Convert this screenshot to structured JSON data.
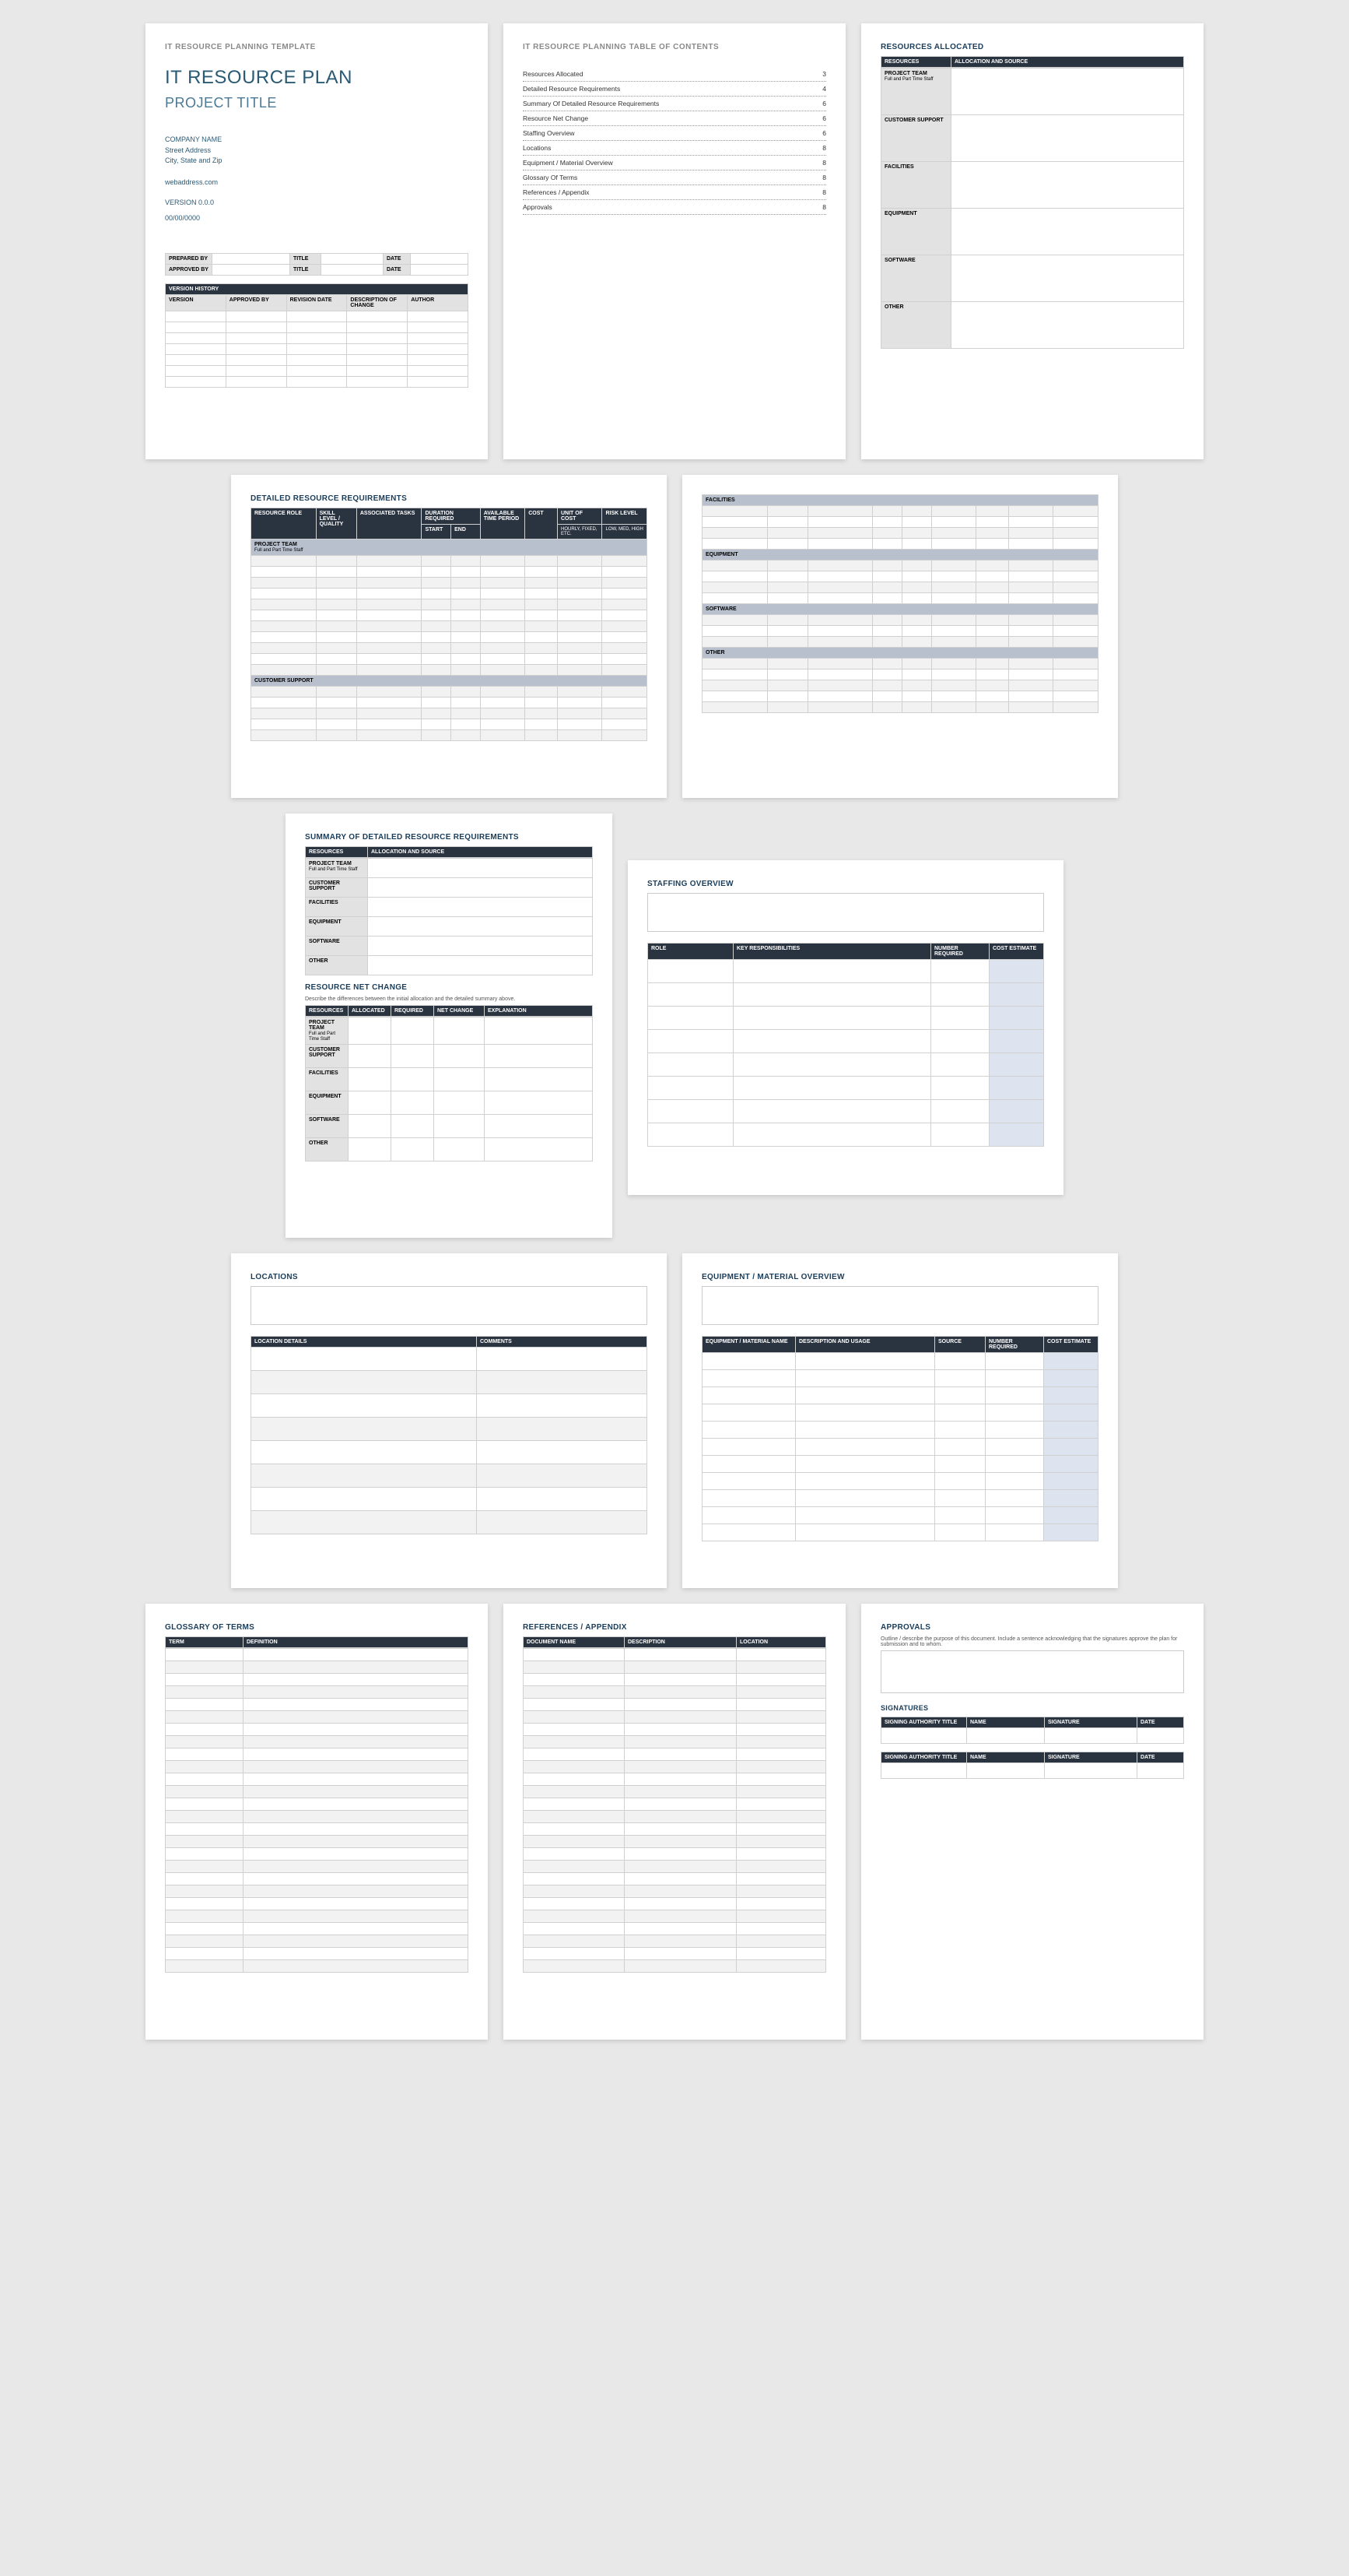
{
  "page1": {
    "header": "IT RESOURCE PLANNING TEMPLATE",
    "title": "IT RESOURCE PLAN",
    "subtitle": "PROJECT TITLE",
    "company": "COMPANY NAME",
    "addr1": "Street Address",
    "addr2": "City, State and Zip",
    "web": "webaddress.com",
    "version": "VERSION 0.0.0",
    "date": "00/00/0000",
    "prep_h1": "PREPARED BY",
    "prep_h2": "TITLE",
    "prep_h3": "DATE",
    "appr_h1": "APPROVED BY",
    "appr_h2": "TITLE",
    "appr_h3": "DATE",
    "vh_title": "VERSION HISTORY",
    "vh_c1": "VERSION",
    "vh_c2": "APPROVED BY",
    "vh_c3": "REVISION DATE",
    "vh_c4": "DESCRIPTION OF CHANGE",
    "vh_c5": "AUTHOR"
  },
  "page2": {
    "header": "IT RESOURCE PLANNING TABLE OF CONTENTS",
    "items": [
      {
        "t": "Resources Allocated",
        "p": "3"
      },
      {
        "t": "Detailed Resource Requirements",
        "p": "4"
      },
      {
        "t": "Summary Of Detailed Resource Requirements",
        "p": "6"
      },
      {
        "t": "Resource Net Change",
        "p": "6"
      },
      {
        "t": "Staffing Overview",
        "p": "6"
      },
      {
        "t": "Locations",
        "p": "8"
      },
      {
        "t": "Equipment / Material Overview",
        "p": "8"
      },
      {
        "t": "Glossary Of Terms",
        "p": "8"
      },
      {
        "t": "References / Appendix",
        "p": "8"
      },
      {
        "t": "Approvals",
        "p": "8"
      }
    ]
  },
  "page3": {
    "title": "RESOURCES ALLOCATED",
    "c1": "RESOURCES",
    "c2": "ALLOCATION AND SOURCE",
    "rows": [
      {
        "a": "PROJECT TEAM",
        "b": "Full and Part Time Staff"
      },
      {
        "a": "CUSTOMER SUPPORT",
        "b": ""
      },
      {
        "a": "FACILITIES",
        "b": ""
      },
      {
        "a": "EQUIPMENT",
        "b": ""
      },
      {
        "a": "SOFTWARE",
        "b": ""
      },
      {
        "a": "OTHER",
        "b": ""
      }
    ]
  },
  "page4": {
    "title": "DETAILED RESOURCE REQUIREMENTS",
    "h1": "RESOURCE ROLE",
    "h2": "SKILL LEVEL / QUALITY",
    "h3": "ASSOCIATED TASKS",
    "h4": "DURATION REQUIRED",
    "h4a": "START",
    "h4b": "END",
    "h5": "AVAILABLE TIME PERIOD",
    "h6": "COST",
    "h7": "UNIT OF COST",
    "h7s": "Hourly, Fixed, etc.",
    "h8": "RISK LEVEL",
    "h8s": "Low, Med, High",
    "g1": "PROJECT TEAM",
    "g1s": "Full and Part Time Staff",
    "g2": "CUSTOMER SUPPORT"
  },
  "page5": {
    "g1": "FACILITIES",
    "g2": "EQUIPMENT",
    "g3": "SOFTWARE",
    "g4": "OTHER"
  },
  "page6": {
    "t1": "SUMMARY OF DETAILED RESOURCE REQUIREMENTS",
    "c1": "RESOURCES",
    "c2": "ALLOCATION AND SOURCE",
    "rows1": [
      {
        "a": "PROJECT TEAM",
        "b": "Full and Part Time Staff"
      },
      {
        "a": "CUSTOMER SUPPORT",
        "b": ""
      },
      {
        "a": "FACILITIES",
        "b": ""
      },
      {
        "a": "EQUIPMENT",
        "b": ""
      },
      {
        "a": "SOFTWARE",
        "b": ""
      },
      {
        "a": "OTHER",
        "b": ""
      }
    ],
    "t2": "RESOURCE NET CHANGE",
    "d2": "Describe the differences between the initial allocation and the detailed summary above.",
    "nc1": "RESOURCES",
    "nc2": "ALLOCATED",
    "nc3": "REQUIRED",
    "nc4": "NET CHANGE",
    "nc5": "EXPLANATION",
    "rows2": [
      {
        "a": "PROJECT TEAM",
        "b": "Full and Part Time Staff"
      },
      {
        "a": "CUSTOMER SUPPORT",
        "b": ""
      },
      {
        "a": "FACILITIES",
        "b": ""
      },
      {
        "a": "EQUIPMENT",
        "b": ""
      },
      {
        "a": "SOFTWARE",
        "b": ""
      },
      {
        "a": "OTHER",
        "b": ""
      }
    ]
  },
  "page7": {
    "title": "STAFFING OVERVIEW",
    "c1": "ROLE",
    "c2": "KEY RESPONSIBILITIES",
    "c3": "NUMBER REQUIRED",
    "c4": "COST ESTIMATE"
  },
  "page8": {
    "title": "LOCATIONS",
    "c1": "LOCATION DETAILS",
    "c2": "COMMENTS"
  },
  "page9": {
    "title": "EQUIPMENT / MATERIAL OVERVIEW",
    "c1": "EQUIPMENT / MATERIAL NAME",
    "c2": "DESCRIPTION AND USAGE",
    "c3": "SOURCE",
    "c4": "NUMBER REQUIRED",
    "c5": "COST ESTIMATE"
  },
  "page10": {
    "title": "GLOSSARY OF TERMS",
    "c1": "TERM",
    "c2": "DEFINITION"
  },
  "page11": {
    "title": "REFERENCES / APPENDIX",
    "c1": "DOCUMENT NAME",
    "c2": "DESCRIPTION",
    "c3": "LOCATION"
  },
  "page12": {
    "title": "APPROVALS",
    "desc": "Outline / describe the purpose of this document. Include a sentence acknowledging that the signatures approve the plan for submission and to whom.",
    "sig": "SIGNATURES",
    "c1": "SIGNING AUTHORITY TITLE",
    "c2": "NAME",
    "c3": "SIGNATURE",
    "c4": "DATE"
  }
}
